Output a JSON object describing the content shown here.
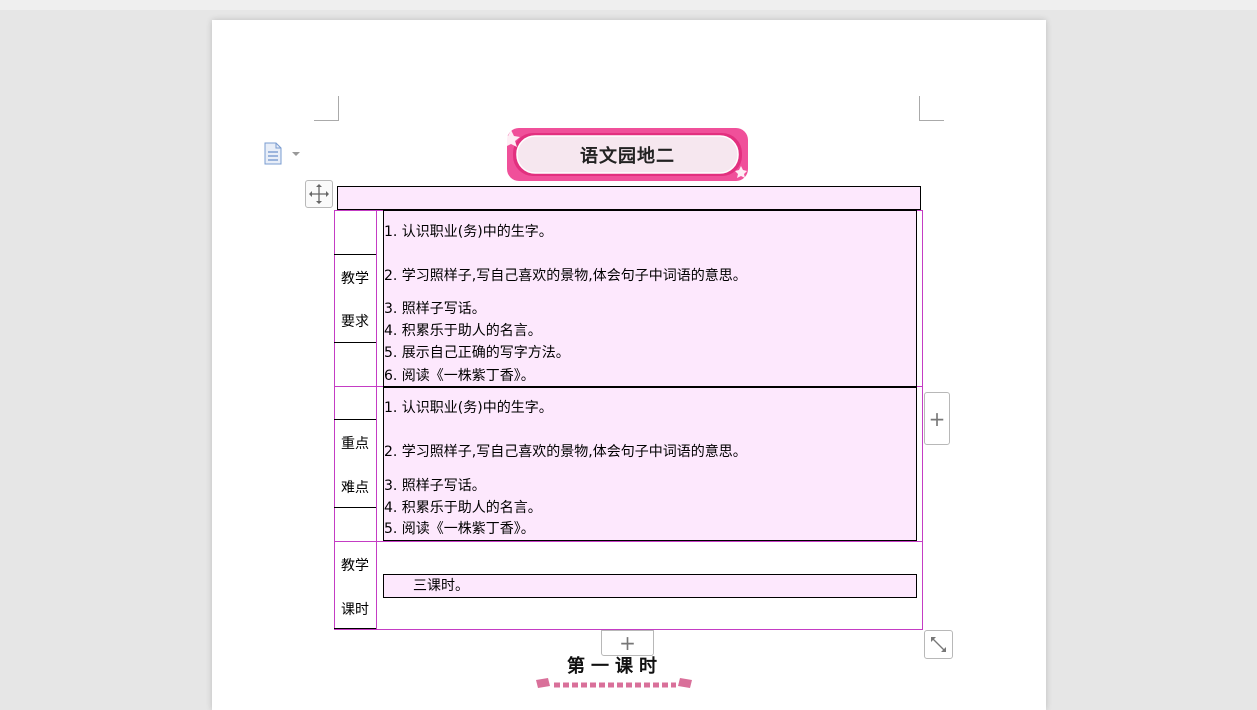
{
  "document": {
    "title": "语文园地二",
    "section_heading": "第一课时"
  },
  "lesson_table": {
    "row1": {
      "label_line1": "教学",
      "label_line2": "要求",
      "items": [
        "1. 认识职业(务)中的生字。",
        "2.  学习照样子,写自己喜欢的景物,体会句子中词语的意思。",
        "3. 照样子写话。",
        "4. 积累乐于助人的名言。",
        "5. 展示自己正确的写字方法。",
        "6. 阅读《一株紫丁香》。"
      ]
    },
    "row2": {
      "label_line1": "重点",
      "label_line2": "难点",
      "items": [
        "1.  认识职业(务)中的生字。",
        "2.  学习照样子,写自己喜欢的景物,体会句子中词语的意思。",
        "3. 照样子写话。",
        "4. 积累乐于助人的名言。",
        "5. 阅读《一株紫丁香》。"
      ]
    },
    "row3": {
      "label_line1": "教学",
      "label_line2": "课时",
      "value": "三课时。"
    }
  },
  "controls": {
    "add_column_symbol": "+",
    "add_row_symbol": "+"
  },
  "colors": {
    "cell_fill": "#fde8fd",
    "table_border": "#c43cc4",
    "banner_pink": "#f0509a"
  }
}
